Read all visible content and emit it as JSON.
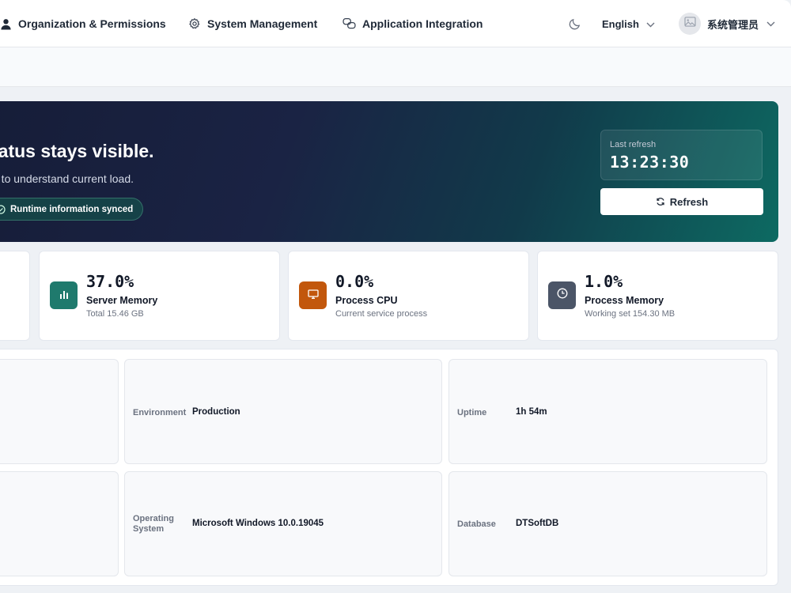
{
  "nav": {
    "items": [
      {
        "label": "Organization & Permissions",
        "icon": "user-icon"
      },
      {
        "label": "System Management",
        "icon": "gear-icon"
      },
      {
        "label": "Application Integration",
        "icon": "link-icon"
      }
    ],
    "theme_icon": "moon-icon",
    "language": "English",
    "user_name": "系统管理员"
  },
  "hero": {
    "title": "tatus stays visible.",
    "subtitle": "e to understand current load.",
    "badge": "Runtime information synced",
    "last_refresh_label": "Last refresh",
    "last_refresh_time": "13:23:30",
    "refresh_label": "Refresh"
  },
  "metrics": [
    {
      "value": "37.0%",
      "title": "Server Memory",
      "desc": "Total 15.46 GB",
      "icon": "bar-chart-icon",
      "color": "#1f7a6d"
    },
    {
      "value": "0.0%",
      "title": "Process CPU",
      "desc": "Current service process",
      "icon": "monitor-icon",
      "color": "#c2570c"
    },
    {
      "value": "1.0%",
      "title": "Process Memory",
      "desc": "Working set 154.30 MB",
      "icon": "clock-icon",
      "color": "#4b5567"
    }
  ],
  "info": {
    "environment_label": "Environment",
    "environment_value": "Production",
    "uptime_label": "Uptime",
    "uptime_value": "1h 54m",
    "os_label": "Operating System",
    "os_value": "Microsoft Windows 10.0.19045",
    "database_label": "Database",
    "database_value": "DTSoftDB"
  },
  "colors": {
    "accent_teal": "#1f7a6d",
    "accent_orange": "#c2570c",
    "accent_slate": "#4b5567",
    "hero_start": "#161d38",
    "hero_end": "#0d6a62"
  }
}
